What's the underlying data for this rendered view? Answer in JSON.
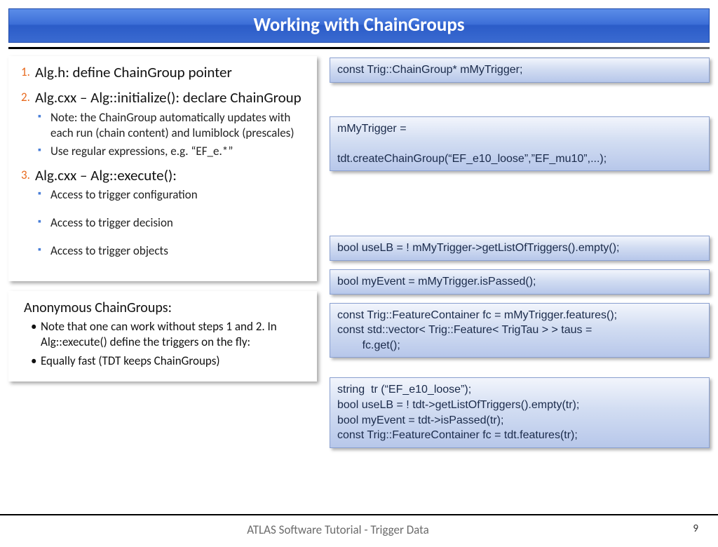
{
  "title": "Working with ChainGroups",
  "left": {
    "items": [
      {
        "head": "Alg.h: define ChainGroup pointer",
        "subs": []
      },
      {
        "head": "Alg.cxx – Alg::initialize(): declare ChainGroup",
        "subs": [
          "Note: the ChainGroup automatically updates with each run (chain content) and lumiblock (prescales)",
          "Use regular expressions, e.g. “EF_e.*”"
        ]
      },
      {
        "head": "Alg.cxx – Alg::execute():",
        "subs": [
          "Access to trigger configuration",
          "Access to trigger decision",
          "Access to trigger objects"
        ]
      }
    ],
    "anon": {
      "head": "Anonymous ChainGroups:",
      "subs": [
        "Note that one can work without steps 1 and 2. In Alg::execute() define the triggers on the fly:",
        "Equally fast (TDT keeps ChainGroups)"
      ]
    }
  },
  "code": {
    "b1": "const Trig::ChainGroup* mMyTrigger;",
    "b2": "mMyTrigger =\n\ntdt.createChainGroup(“EF_e10_loose”,”EF_mu10”,...);",
    "b3": "bool useLB = ! mMyTrigger->getListOfTriggers().empty();",
    "b4": "bool myEvent = mMyTrigger.isPassed();",
    "b5": "const Trig::FeatureContainer fc = mMyTrigger.features();\nconst std::vector< Trig::Feature< TrigTau > > taus =\n        fc.get();",
    "b6": "string  tr (“EF_e10_loose”);\nbool useLB = ! tdt->getListOfTriggers().empty(tr);\nbool myEvent = tdt->isPassed(tr);\nconst Trig::FeatureContainer fc = tdt.features(tr);"
  },
  "footer": {
    "text": "ATLAS Software Tutorial - Trigger Data",
    "page": "9"
  }
}
